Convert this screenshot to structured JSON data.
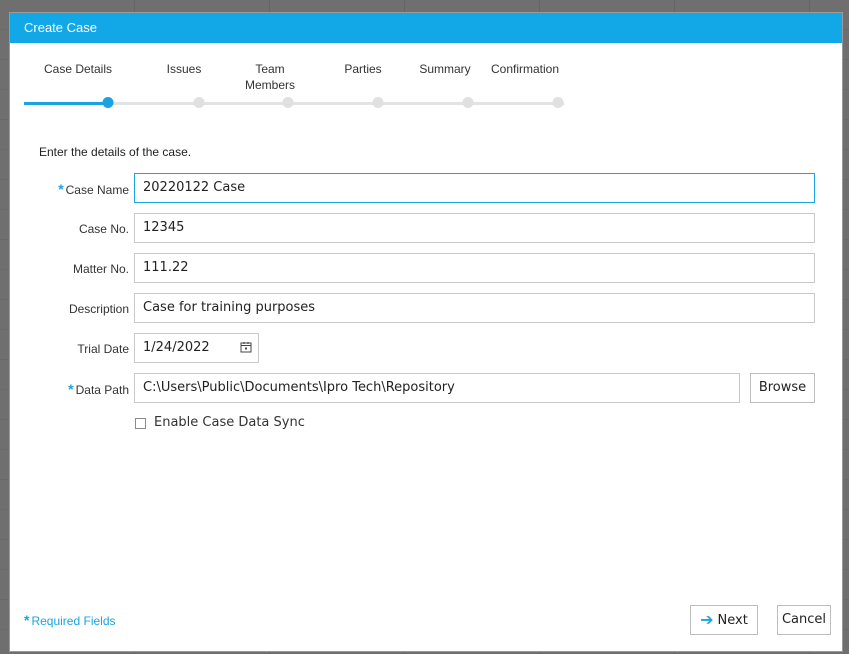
{
  "dialog": {
    "title": "Create Case"
  },
  "steps": [
    {
      "label": "Case Details",
      "active": true
    },
    {
      "label": "Issues",
      "active": false
    },
    {
      "label": "Team\nMembers",
      "active": false
    },
    {
      "label": "Parties",
      "active": false
    },
    {
      "label": "Summary",
      "active": false
    },
    {
      "label": "Confirmation",
      "active": false
    }
  ],
  "form": {
    "intro": "Enter the details of the case.",
    "case_name": {
      "label": "Case Name",
      "value": "20220122 Case",
      "required": true
    },
    "case_no": {
      "label": "Case No.",
      "value": "12345"
    },
    "matter_no": {
      "label": "Matter No.",
      "value": "111.22"
    },
    "description": {
      "label": "Description",
      "value": "Case for training purposes"
    },
    "trial_date": {
      "label": "Trial Date",
      "value": "1/24/2022"
    },
    "data_path": {
      "label": "Data Path",
      "value": "C:\\Users\\Public\\Documents\\Ipro Tech\\Repository",
      "required": true
    },
    "browse_label": "Browse",
    "sync_label": "Enable Case Data Sync",
    "required_star": "*"
  },
  "footer": {
    "required_note": "Required Fields",
    "next_label": "Next",
    "cancel_label": "Cancel"
  },
  "colors": {
    "accent": "#1aa3e0",
    "titlebar": "#12a7e6"
  }
}
